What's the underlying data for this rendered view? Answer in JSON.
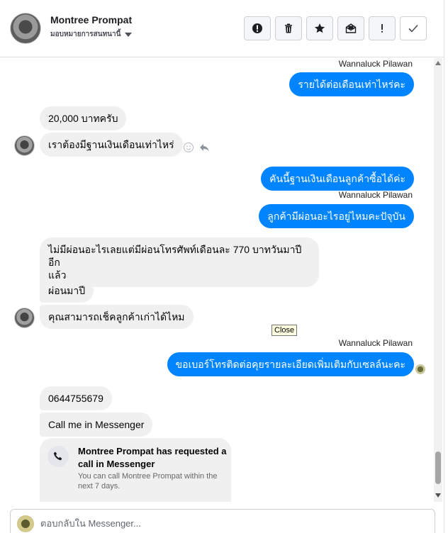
{
  "header": {
    "contact_name": "Montree Prompat",
    "assign_label": "มอบหมายการสนทนานี้"
  },
  "toolbar": {
    "spam_icon": "alert-circle-icon",
    "delete_icon": "trash-icon",
    "star_icon": "star-icon",
    "unread_icon": "mail-icon",
    "important_icon": "exclamation-icon",
    "done_icon": "check-icon"
  },
  "messages": [
    {
      "dir": "out",
      "sender": "Wannaluck Pilawan",
      "text": "รายได้ต่อเดือนเท่าไหร่คะ"
    },
    {
      "dir": "in",
      "text": "20,000 บาทครับ"
    },
    {
      "dir": "in",
      "text": "เราต้องมีฐานเงินเดือนเท่าไหร่"
    },
    {
      "dir": "out",
      "text": "คันนี้ฐานเงินเดือนลูกค้าซื้อได้ค่ะ"
    },
    {
      "dir": "out",
      "sender": "Wannaluck Pilawan",
      "text": "ลูกค้ามีผ่อนอะไรอยู่ไหมคะปัจุบัน"
    },
    {
      "dir": "in",
      "text_line1": "ไม่มีผ่อนอะไรเลยแต่มีผ่อนโทรศัพท์เดือนละ 770 บาทวันมาปีอีก",
      "text_line2": "แล้ว"
    },
    {
      "dir": "in",
      "text": "ผ่อนมาปี"
    },
    {
      "dir": "in",
      "text": "คุณสามารถเช็คลูกค้าเก่าได้ไหม"
    },
    {
      "dir": "out",
      "sender": "Wannaluck Pilawan",
      "text": "ขอเบอร์โทรติดต่อคุยรายละเอียดเพิ่มเติมกับเซลล์นะคะ"
    },
    {
      "dir": "in",
      "text": "0644755679"
    },
    {
      "dir": "in",
      "text": "Call me in Messenger"
    }
  ],
  "tooltip": "Close",
  "call_card": {
    "title": "Montree Prompat has requested a call in Messenger",
    "subtitle": "You can call Montree Prompat within the next 7 days.",
    "icon": "phone-icon"
  },
  "composer": {
    "placeholder": "ตอบกลับใน Messenger..."
  },
  "colors": {
    "outgoing_bubble": "#0084ff",
    "incoming_bubble": "#f0f0f0"
  }
}
